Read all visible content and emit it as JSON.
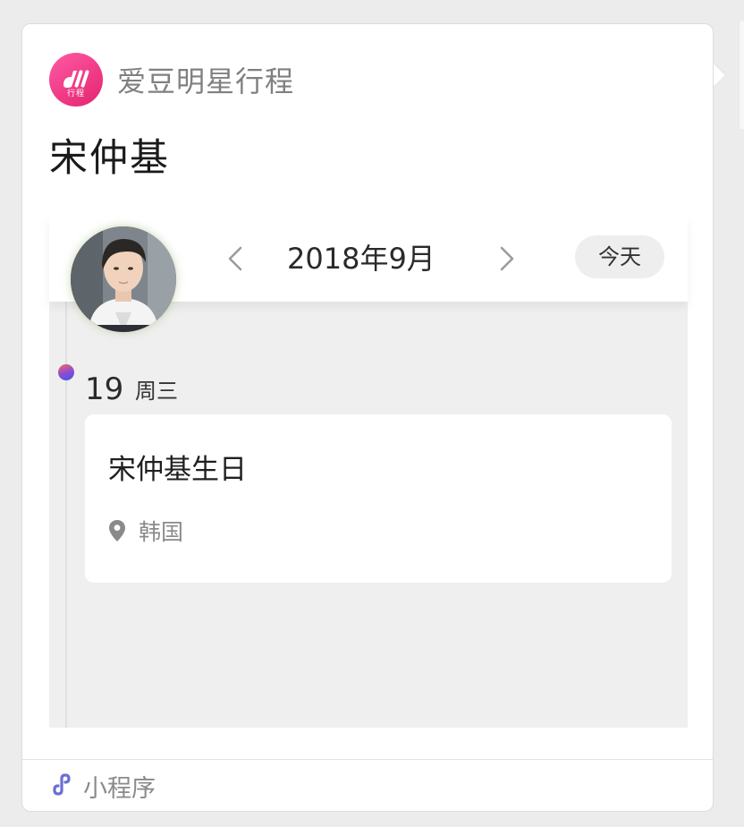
{
  "app": {
    "name": "爱豆明星行程",
    "logo_text": "行程",
    "logo_color": "#f0338a"
  },
  "celebrity": {
    "name": "宋仲基"
  },
  "calendar": {
    "month_label": "2018年9月",
    "prev_icon": "chevron-left-icon",
    "next_icon": "chevron-right-icon",
    "today_label": "今天"
  },
  "day": {
    "number": "19",
    "weekday": "周三"
  },
  "event": {
    "title": "宋仲基生日",
    "location_icon": "map-pin-icon",
    "location": "韩国"
  },
  "footer": {
    "icon": "mini-program-link-icon",
    "label": "小程序",
    "icon_color": "#6b6fd6"
  }
}
